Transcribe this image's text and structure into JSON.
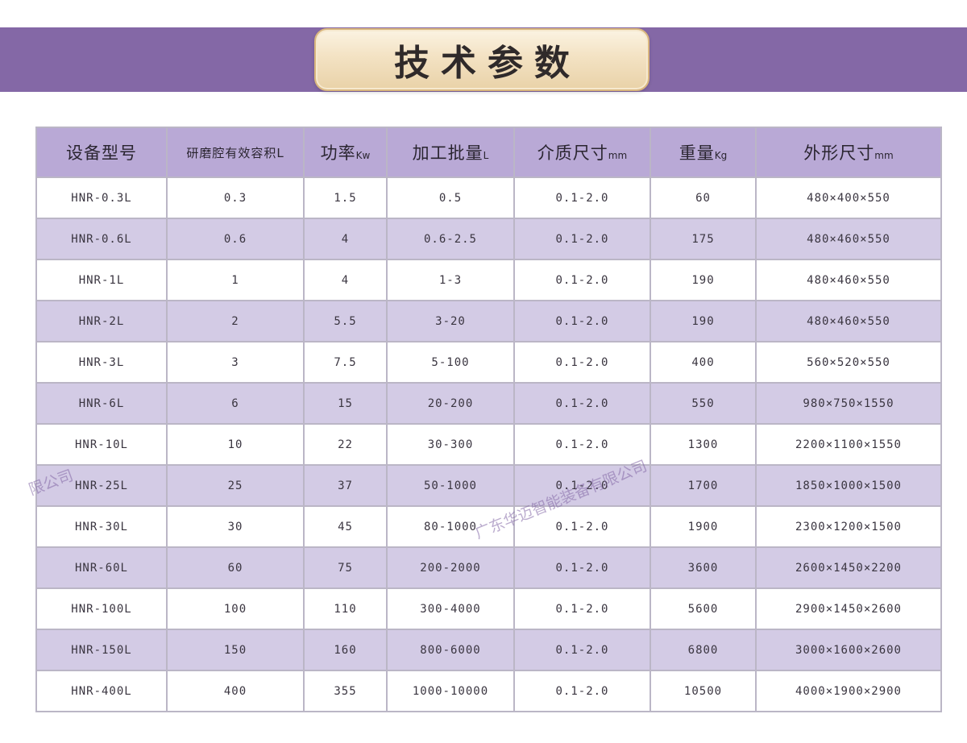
{
  "page": {
    "title": "技术参数",
    "watermark_text_1": "广东华迈智能装备有限公司",
    "watermark_text_2": "限公司"
  },
  "colors": {
    "band": "#8468a6",
    "header_bg": "#b9a9d6",
    "row_alt_bg": "#d3cbe5",
    "title_plate": "#f3e2c3"
  },
  "table": {
    "headers": [
      {
        "label": "设备型号",
        "unit": ""
      },
      {
        "label": "研磨腔有效容积L",
        "unit": ""
      },
      {
        "label": "功率",
        "unit": "Kw"
      },
      {
        "label": "加工批量",
        "unit": "L"
      },
      {
        "label": "介质尺寸",
        "unit": "mm"
      },
      {
        "label": "重量",
        "unit": "Kg"
      },
      {
        "label": "外形尺寸",
        "unit": "mm"
      }
    ],
    "rows": [
      [
        "HNR-0.3L",
        "0.3",
        "1.5",
        "0.5",
        "0.1-2.0",
        "60",
        "480×400×550"
      ],
      [
        "HNR-0.6L",
        "0.6",
        "4",
        "0.6-2.5",
        "0.1-2.0",
        "175",
        "480×460×550"
      ],
      [
        "HNR-1L",
        "1",
        "4",
        "1-3",
        "0.1-2.0",
        "190",
        "480×460×550"
      ],
      [
        "HNR-2L",
        "2",
        "5.5",
        "3-20",
        "0.1-2.0",
        "190",
        "480×460×550"
      ],
      [
        "HNR-3L",
        "3",
        "7.5",
        "5-100",
        "0.1-2.0",
        "400",
        "560×520×550"
      ],
      [
        "HNR-6L",
        "6",
        "15",
        "20-200",
        "0.1-2.0",
        "550",
        "980×750×1550"
      ],
      [
        "HNR-10L",
        "10",
        "22",
        "30-300",
        "0.1-2.0",
        "1300",
        "2200×1100×1550"
      ],
      [
        "HNR-25L",
        "25",
        "37",
        "50-1000",
        "0.1-2.0",
        "1700",
        "1850×1000×1500"
      ],
      [
        "HNR-30L",
        "30",
        "45",
        "80-1000",
        "0.1-2.0",
        "1900",
        "2300×1200×1500"
      ],
      [
        "HNR-60L",
        "60",
        "75",
        "200-2000",
        "0.1-2.0",
        "3600",
        "2600×1450×2200"
      ],
      [
        "HNR-100L",
        "100",
        "110",
        "300-4000",
        "0.1-2.0",
        "5600",
        "2900×1450×2600"
      ],
      [
        "HNR-150L",
        "150",
        "160",
        "800-6000",
        "0.1-2.0",
        "6800",
        "3000×1600×2600"
      ],
      [
        "HNR-400L",
        "400",
        "355",
        "1000-10000",
        "0.1-2.0",
        "10500",
        "4000×1900×2900"
      ]
    ]
  }
}
